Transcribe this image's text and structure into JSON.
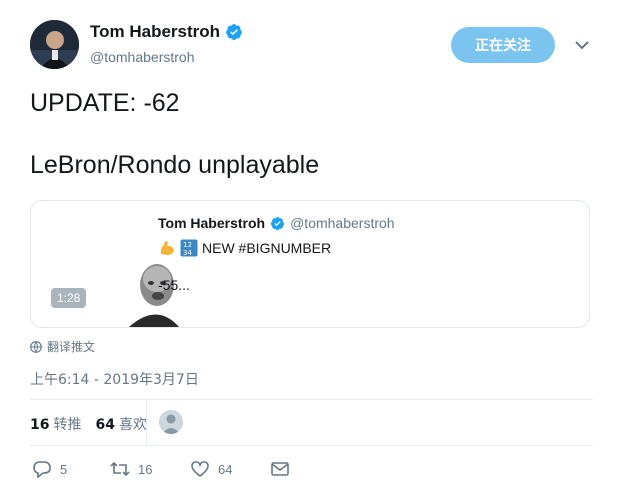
{
  "author": {
    "display_name": "Tom Haberstroh",
    "handle": "@tomhaberstroh",
    "avatar_icon": "avatar-photo",
    "verified_icon": "verified-badge-icon"
  },
  "follow_button": {
    "label": "正在关注"
  },
  "menu_icon": "chevron-down-icon",
  "tweet": {
    "line1": "UPDATE: -62",
    "line2": "LeBron/Rondo unplayable"
  },
  "quote": {
    "display_name": "Tom Haberstroh",
    "handle": "@tomhaberstroh",
    "line1": "NEW #BIGNUMBER",
    "line2": "-55...",
    "video_duration": "1:28",
    "emoji_icons": [
      "flexed-biceps-emoji",
      "number-input-emoji"
    ]
  },
  "translate": {
    "label": "翻译推文"
  },
  "timestamp": "上午6:14 - 2019年3月7日",
  "stats": {
    "retweets_count": "16",
    "retweets_label": "转推",
    "likes_count": "64",
    "likes_label": "喜欢"
  },
  "actions": {
    "reply_count": "5",
    "retweet_count": "16",
    "like_count": "64"
  },
  "colors": {
    "follow_button": "#7bc4f0",
    "verified": "#1da1f2",
    "secondary_text": "#657786"
  }
}
